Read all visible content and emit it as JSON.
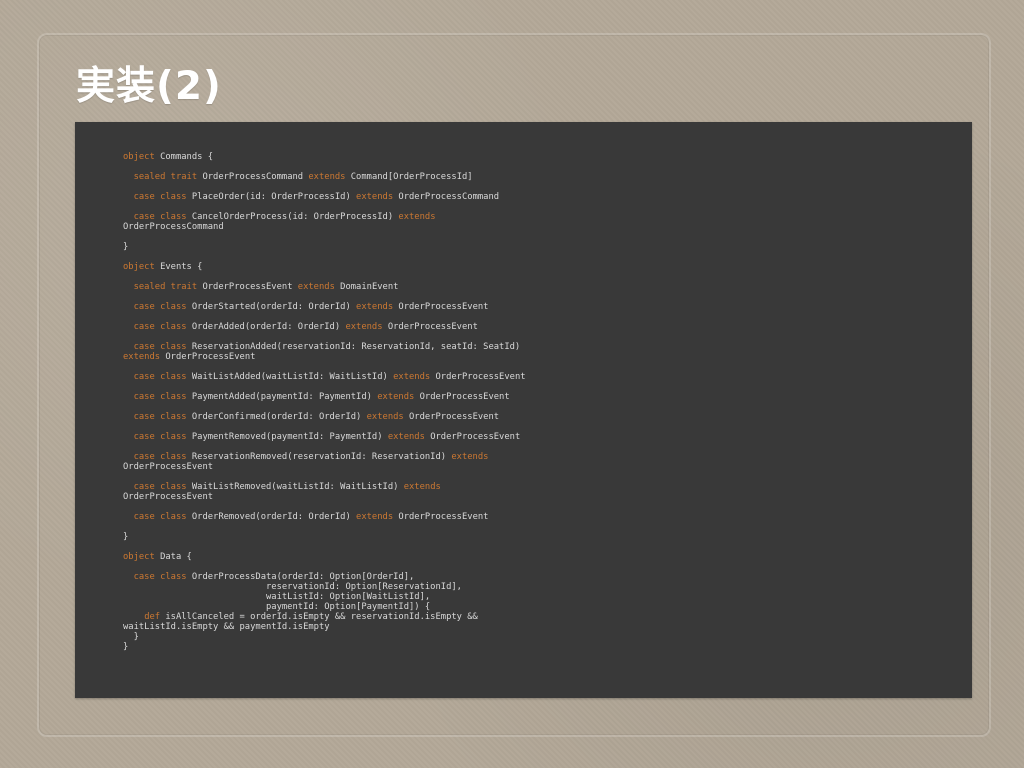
{
  "slide": {
    "title": "実装(2)"
  },
  "code": {
    "lines": [
      [
        {
          "t": "object",
          "k": 1
        },
        {
          "t": " Commands {"
        }
      ],
      [],
      [
        {
          "t": "  "
        },
        {
          "t": "sealed trait",
          "k": 1
        },
        {
          "t": " OrderProcessCommand "
        },
        {
          "t": "extends",
          "k": 1
        },
        {
          "t": " Command[OrderProcessId]"
        }
      ],
      [],
      [
        {
          "t": "  "
        },
        {
          "t": "case class",
          "k": 1
        },
        {
          "t": " PlaceOrder(id: OrderProcessId) "
        },
        {
          "t": "extends",
          "k": 1
        },
        {
          "t": " OrderProcessCommand"
        }
      ],
      [],
      [
        {
          "t": "  "
        },
        {
          "t": "case class",
          "k": 1
        },
        {
          "t": " CancelOrderProcess(id: OrderProcessId) "
        },
        {
          "t": "extends",
          "k": 1
        }
      ],
      [
        {
          "t": "OrderProcessCommand"
        }
      ],
      [],
      [
        {
          "t": "}"
        }
      ],
      [],
      [
        {
          "t": "object",
          "k": 1
        },
        {
          "t": " Events {"
        }
      ],
      [],
      [
        {
          "t": "  "
        },
        {
          "t": "sealed trait",
          "k": 1
        },
        {
          "t": " OrderProcessEvent "
        },
        {
          "t": "extends",
          "k": 1
        },
        {
          "t": " DomainEvent"
        }
      ],
      [],
      [
        {
          "t": "  "
        },
        {
          "t": "case class",
          "k": 1
        },
        {
          "t": " OrderStarted(orderId: OrderId) "
        },
        {
          "t": "extends",
          "k": 1
        },
        {
          "t": " OrderProcessEvent"
        }
      ],
      [],
      [
        {
          "t": "  "
        },
        {
          "t": "case class",
          "k": 1
        },
        {
          "t": " OrderAdded(orderId: OrderId) "
        },
        {
          "t": "extends",
          "k": 1
        },
        {
          "t": " OrderProcessEvent"
        }
      ],
      [],
      [
        {
          "t": "  "
        },
        {
          "t": "case class",
          "k": 1
        },
        {
          "t": " ReservationAdded(reservationId: ReservationId, seatId: SeatId)"
        }
      ],
      [
        {
          "t": "extends",
          "k": 1
        },
        {
          "t": " OrderProcessEvent"
        }
      ],
      [],
      [
        {
          "t": "  "
        },
        {
          "t": "case class",
          "k": 1
        },
        {
          "t": " WaitListAdded(waitListId: WaitListId) "
        },
        {
          "t": "extends",
          "k": 1
        },
        {
          "t": " OrderProcessEvent"
        }
      ],
      [],
      [
        {
          "t": "  "
        },
        {
          "t": "case class",
          "k": 1
        },
        {
          "t": " PaymentAdded(paymentId: PaymentId) "
        },
        {
          "t": "extends",
          "k": 1
        },
        {
          "t": " OrderProcessEvent"
        }
      ],
      [],
      [
        {
          "t": "  "
        },
        {
          "t": "case class",
          "k": 1
        },
        {
          "t": " OrderConfirmed(orderId: OrderId) "
        },
        {
          "t": "extends",
          "k": 1
        },
        {
          "t": " OrderProcessEvent"
        }
      ],
      [],
      [
        {
          "t": "  "
        },
        {
          "t": "case class",
          "k": 1
        },
        {
          "t": " PaymentRemoved(paymentId: PaymentId) "
        },
        {
          "t": "extends",
          "k": 1
        },
        {
          "t": " OrderProcessEvent"
        }
      ],
      [],
      [
        {
          "t": "  "
        },
        {
          "t": "case class",
          "k": 1
        },
        {
          "t": " ReservationRemoved(reservationId: ReservationId) "
        },
        {
          "t": "extends",
          "k": 1
        }
      ],
      [
        {
          "t": "OrderProcessEvent"
        }
      ],
      [],
      [
        {
          "t": "  "
        },
        {
          "t": "case class",
          "k": 1
        },
        {
          "t": " WaitListRemoved(waitListId: WaitListId) "
        },
        {
          "t": "extends",
          "k": 1
        }
      ],
      [
        {
          "t": "OrderProcessEvent"
        }
      ],
      [],
      [
        {
          "t": "  "
        },
        {
          "t": "case class",
          "k": 1
        },
        {
          "t": " OrderRemoved(orderId: OrderId) "
        },
        {
          "t": "extends",
          "k": 1
        },
        {
          "t": " OrderProcessEvent"
        }
      ],
      [],
      [
        {
          "t": "}"
        }
      ],
      [],
      [
        {
          "t": "object",
          "k": 1
        },
        {
          "t": " Data {"
        }
      ],
      [],
      [
        {
          "t": "  "
        },
        {
          "t": "case class",
          "k": 1
        },
        {
          "t": " OrderProcessData(orderId: Option[OrderId],"
        }
      ],
      [
        {
          "t": "                           reservationId: Option[ReservationId],"
        }
      ],
      [
        {
          "t": "                           waitListId: Option[WaitListId],"
        }
      ],
      [
        {
          "t": "                           paymentId: Option[PaymentId]) {"
        }
      ],
      [
        {
          "t": "    "
        },
        {
          "t": "def",
          "k": 1
        },
        {
          "t": " isAllCanceled = orderId.isEmpty && reservationId.isEmpty &&"
        }
      ],
      [
        {
          "t": "waitListId.isEmpty && paymentId.isEmpty"
        }
      ],
      [
        {
          "t": "  }"
        }
      ],
      [
        {
          "t": "}"
        }
      ]
    ]
  }
}
